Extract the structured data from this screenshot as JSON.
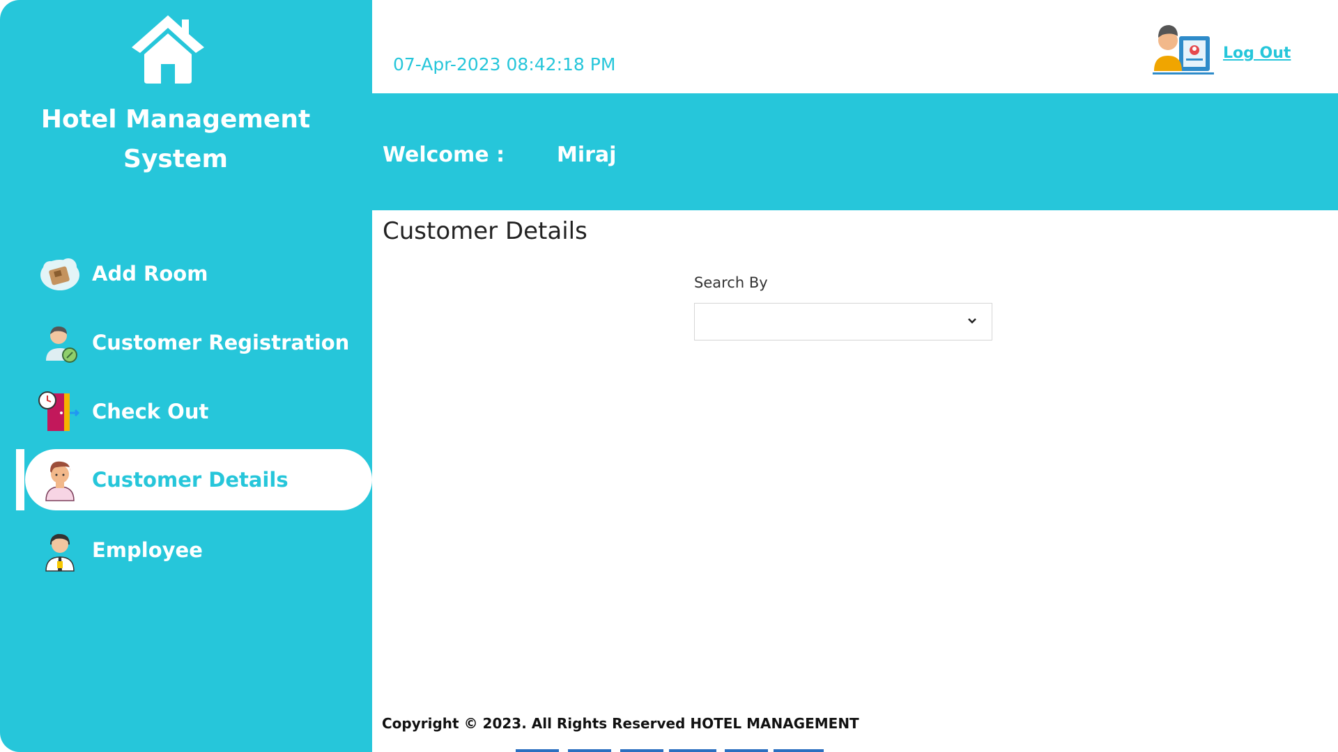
{
  "app": {
    "title": "Hotel Management System",
    "brand_color": "#26c6da",
    "logo_icon": "house-icon"
  },
  "sidebar": {
    "items": [
      {
        "label": "Add Room",
        "icon": "room-icon",
        "active": false
      },
      {
        "label": "Customer Registration",
        "icon": "customer-registration-icon",
        "active": false
      },
      {
        "label": "Check Out",
        "icon": "check-out-door-icon",
        "active": false
      },
      {
        "label": "Customer Details",
        "icon": "customer-avatar-icon",
        "active": true
      },
      {
        "label": "Employee",
        "icon": "employee-icon",
        "active": false
      }
    ]
  },
  "header": {
    "datetime": "07-Apr-2023 08:42:18 PM",
    "user_icon": "user-profile-icon",
    "logout_label": "Log Out",
    "welcome_label": "Welcome :",
    "user_name": "Miraj"
  },
  "main": {
    "page_title": "Customer Details",
    "search": {
      "label": "Search By",
      "selected_value": ""
    }
  },
  "footer": {
    "copyright": "Copyright © 2023. All Rights Reserved HOTEL MANAGEMENT"
  }
}
